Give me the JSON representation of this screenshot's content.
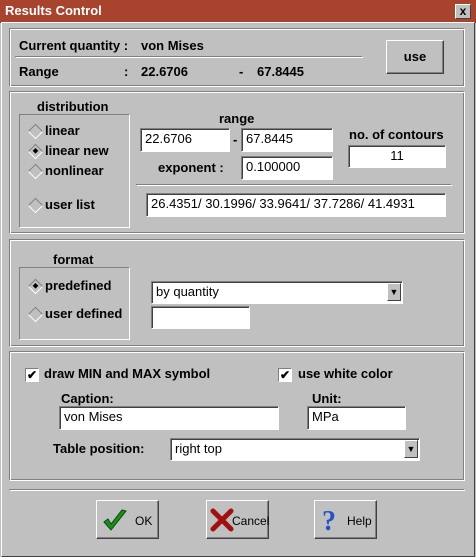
{
  "window": {
    "title": "Results Control",
    "close_glyph": "x"
  },
  "current": {
    "quantity_label": "Current quantity :",
    "quantity_value": "von Mises",
    "range_label": "Range",
    "range_colon": ":",
    "range_min": "22.6706",
    "range_dash": "-",
    "range_max": "67.8445",
    "use_button": "use"
  },
  "distribution": {
    "heading": "distribution",
    "options": [
      {
        "label": "linear",
        "selected": false
      },
      {
        "label": "linear new",
        "selected": true
      },
      {
        "label": "nonlinear",
        "selected": false
      },
      {
        "label": "user list",
        "selected": false
      }
    ],
    "range_heading": "range",
    "range_min": "22.6706",
    "range_dash": "-",
    "range_max": "67.8445",
    "exponent_label": "exponent :",
    "exponent_value": "0.100000",
    "contours_label": "no. of contours",
    "contours_value": "11",
    "user_list_value": "26.4351/ 30.1996/ 33.9641/ 37.7286/ 41.4931"
  },
  "format": {
    "heading": "format",
    "options": [
      {
        "label": "predefined",
        "selected": true
      },
      {
        "label": "user defined",
        "selected": false
      }
    ],
    "predefined_value": "by quantity",
    "user_defined_value": ""
  },
  "display": {
    "draw_minmax_label": "draw MIN and MAX symbol",
    "draw_minmax_checked": true,
    "white_color_label": "use white color",
    "white_color_checked": true,
    "caption_label": "Caption:",
    "caption_value": "von Mises",
    "unit_label": "Unit:",
    "unit_value": "MPa",
    "table_position_label": "Table position:",
    "table_position_value": "right top"
  },
  "buttons": {
    "ok": "OK",
    "cancel": "Cancel",
    "help": "Help"
  },
  "icons": {
    "ok": "checkmark-icon",
    "cancel": "x-icon",
    "help": "question-icon",
    "colors": {
      "ok": "#1c8c1c",
      "cancel": "#a01010",
      "help": "#2850c8"
    }
  }
}
